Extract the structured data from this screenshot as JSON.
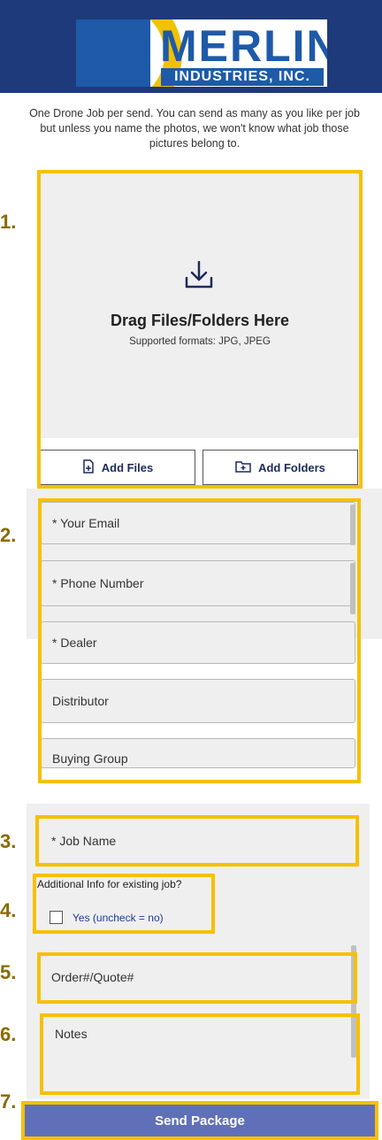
{
  "header": {
    "logo_name": "MERLIN",
    "logo_sub": "INDUSTRIES, INC."
  },
  "intro_text": "One Drone Job per send. You can send as many as you like per job but unless you name the photos, we won't know what job those pictures belong to.",
  "dropzone": {
    "title": "Drag Files/Folders Here",
    "formats": "Supported formats: JPG, JPEG",
    "add_files_label": "Add Files",
    "add_folders_label": "Add Folders"
  },
  "form": {
    "email_placeholder": "* Your Email",
    "phone_placeholder": "* Phone Number",
    "dealer_placeholder": "* Dealer",
    "distributor_placeholder": "Distributor",
    "buying_group_placeholder": "Buying Group",
    "job_name_placeholder": "* Job Name",
    "existing_job_question": "Additional Info for existing job?",
    "existing_job_checkbox_label": "Yes (uncheck = no)",
    "order_quote_placeholder": "Order#/Quote#",
    "notes_placeholder": "Notes",
    "send_label": "Send Package"
  },
  "annotations": [
    "1.",
    "2.",
    "3.",
    "4.",
    "5.",
    "6.",
    "7."
  ],
  "colors": {
    "header_bg": "#1e3a7a",
    "brand_blue": "#1e5aa8",
    "brand_yellow": "#f2c200",
    "highlight": "#f6c000",
    "send_button": "#6070b8"
  }
}
